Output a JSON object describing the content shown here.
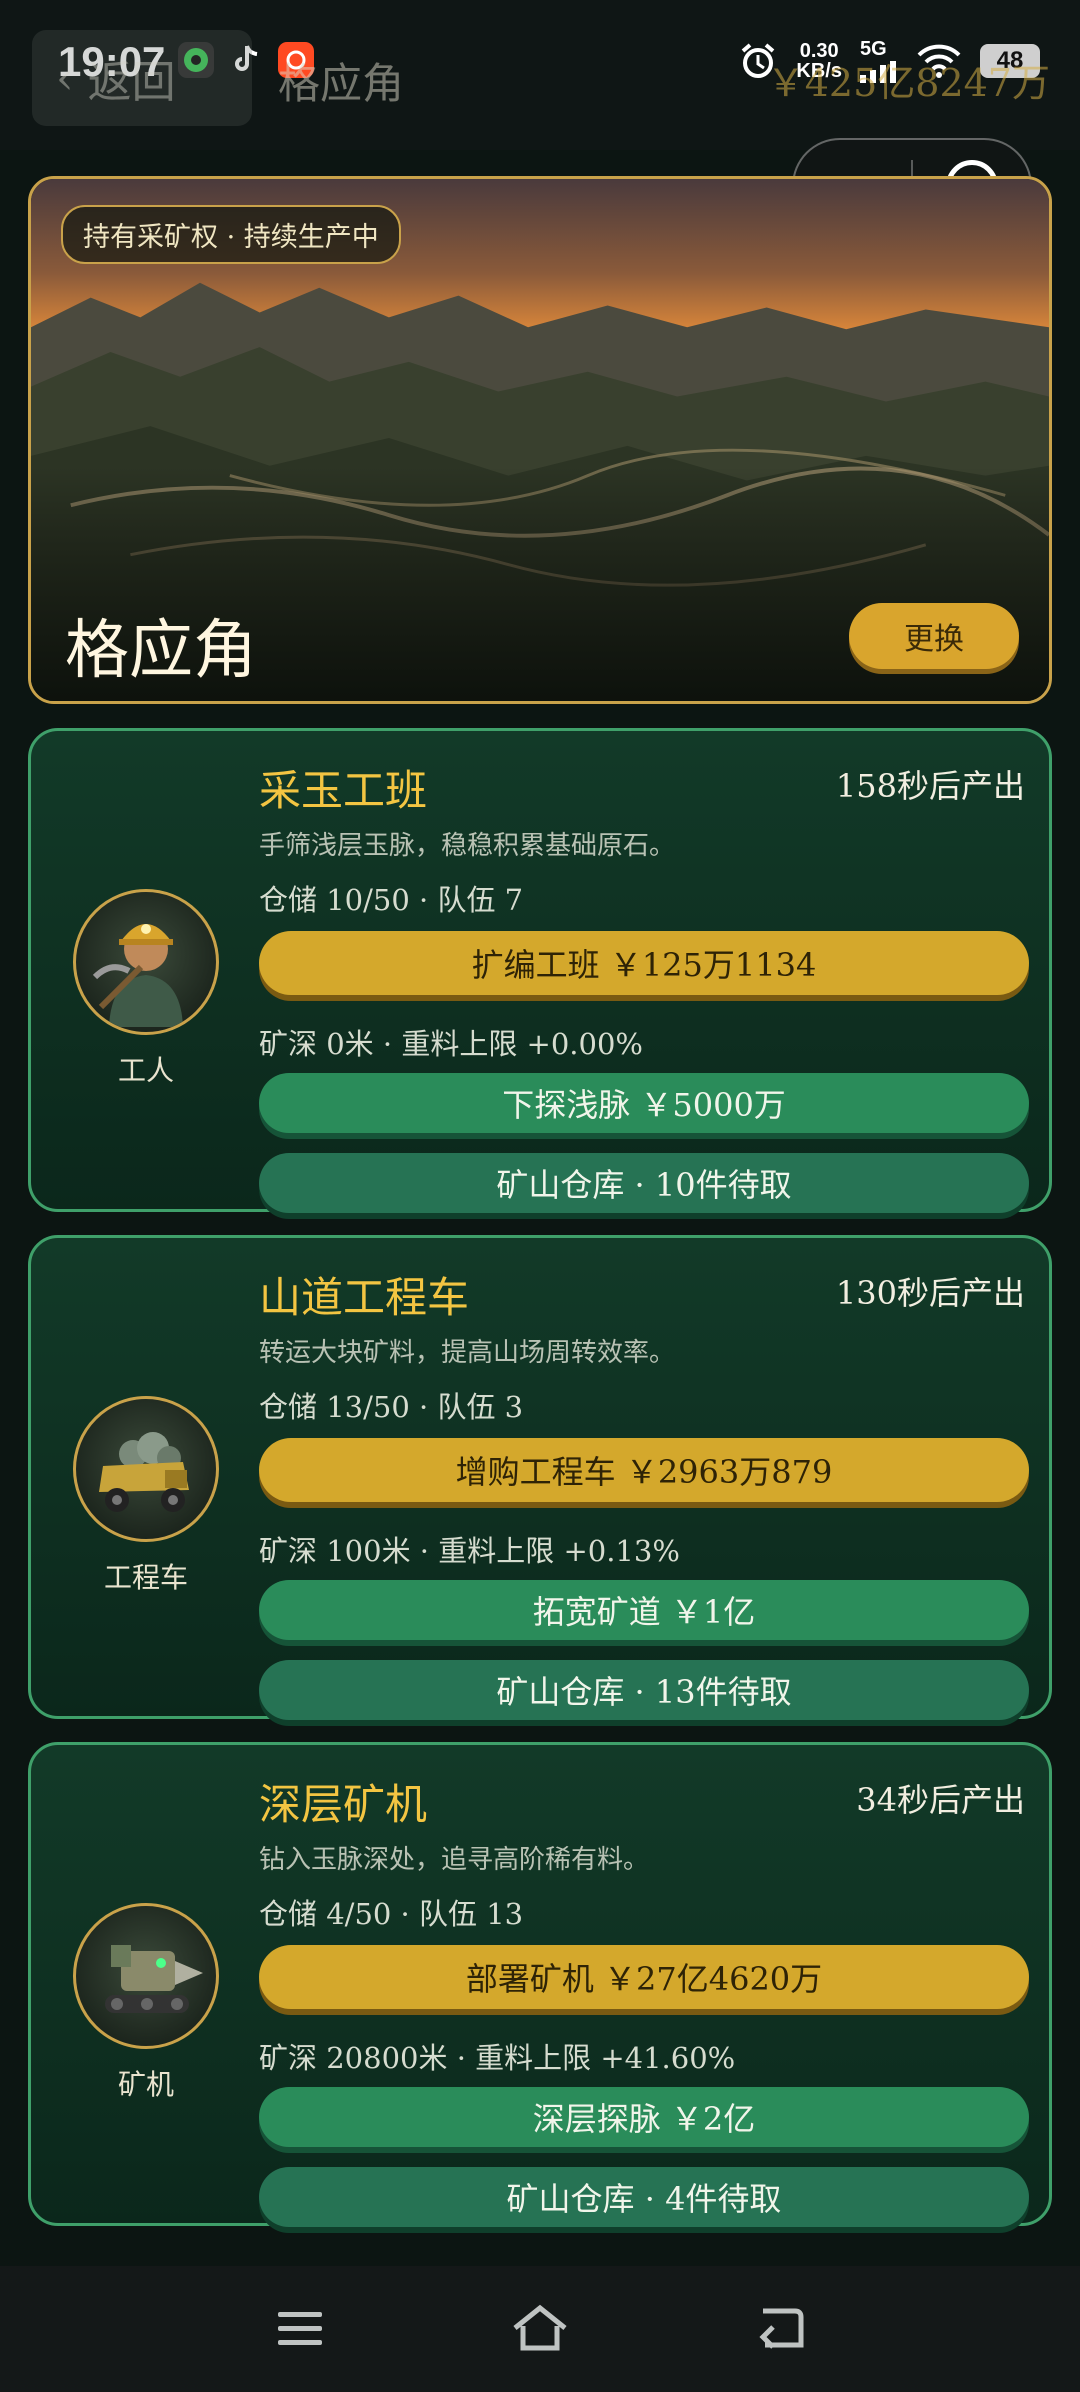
{
  "status_bar": {
    "time": "19:07",
    "net_speed_value": "0.30",
    "net_speed_unit": "KB/s",
    "signal": "5G",
    "battery": "48"
  },
  "header": {
    "back_label": "返回",
    "title": "格应角",
    "money": "￥425亿8247万"
  },
  "hero": {
    "badge": "持有采矿权 · 持续生产中",
    "name": "格应角",
    "change_label": "更换"
  },
  "units": [
    {
      "title": "采玉工班",
      "timer": "158秒后产出",
      "desc": "手筛浅层玉脉，稳稳积累基础原石。",
      "stats": "仓储 10/50 · 队伍 7",
      "upgrade": "扩编工班 ￥125万1134",
      "depth": "矿深 0米 · 重料上限 +0.00%",
      "explore": "下探浅脉 ￥5000万",
      "store": "矿山仓库 · 10件待取",
      "portrait_label": "工人",
      "portrait_icon": "worker-icon"
    },
    {
      "title": "山道工程车",
      "timer": "130秒后产出",
      "desc": "转运大块矿料，提高山场周转效率。",
      "stats": "仓储 13/50 · 队伍 3",
      "upgrade": "增购工程车 ￥2963万879",
      "depth": "矿深 100米 · 重料上限 +0.13%",
      "explore": "拓宽矿道 ￥1亿",
      "store": "矿山仓库 · 13件待取",
      "portrait_label": "工程车",
      "portrait_icon": "truck-icon"
    },
    {
      "title": "深层矿机",
      "timer": "34秒后产出",
      "desc": "钻入玉脉深处，追寻高阶稀有料。",
      "stats": "仓储 4/50 · 队伍 13",
      "upgrade": "部署矿机 ￥27亿4620万",
      "depth": "矿深 20800米 · 重料上限 +41.60%",
      "explore": "深层探脉 ￥2亿",
      "store": "矿山仓库 · 4件待取",
      "portrait_label": "矿机",
      "portrait_icon": "drill-machine-icon"
    }
  ],
  "colors": {
    "gold": "#d4a82c",
    "green": "#2a8c5a",
    "card_border": "#3fa06a",
    "title_gold": "#f3c542"
  }
}
